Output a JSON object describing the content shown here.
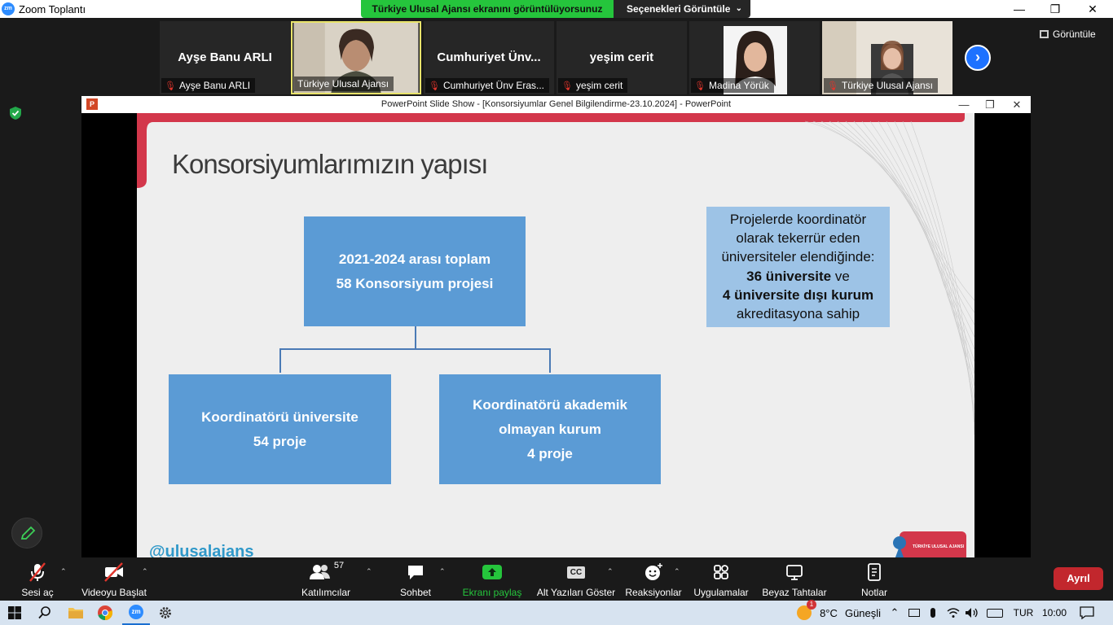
{
  "app": {
    "title": "Zoom Toplantı",
    "logo_text": "zm"
  },
  "share_banner": {
    "text": "Türkiye Ulusal Ajansı ekranını görüntülüyorsunuz",
    "options_label": "Seçenekleri Görüntüle"
  },
  "window_controls": {
    "minimize": "—",
    "restore": "❐",
    "close": "✕"
  },
  "gallery": {
    "view_label": "Görüntüle",
    "participants": [
      {
        "big_name": "Ayşe Banu ARLI",
        "label": "Ayşe Banu ARLI",
        "video": false
      },
      {
        "big_name": "",
        "label": "Türkiye Ulusal Ajansı",
        "video": true,
        "active": true
      },
      {
        "big_name": "Cumhuriyet  Ünv...",
        "label": "Cumhuriyet Ünv Eras...",
        "video": false
      },
      {
        "big_name": "yeşim cerit",
        "label": "yeşim cerit",
        "video": false
      },
      {
        "big_name": "",
        "label": "Madina Yörük",
        "video": true
      },
      {
        "big_name": "",
        "label": "Türkiye Ulusal Ajansı",
        "video": true
      }
    ]
  },
  "ppt": {
    "icon_text": "P",
    "window_title": "PowerPoint Slide Show  -  [Konsorsiyumlar Genel Bilgilendirme-23.10.2024]  -  PowerPoint",
    "slide": {
      "title": "Konsorsiyumlarımızın yapısı",
      "top_box": {
        "line1": "2021-2024 arası toplam",
        "line2": "58 Konsorsiyum projesi"
      },
      "left_box": {
        "line1": "Koordinatörü üniversite",
        "line2": "54 proje"
      },
      "right_box": {
        "line1": "Koordinatörü akademik",
        "line2": "olmayan kurum",
        "line3": "4 proje"
      },
      "info": {
        "line1": "Projelerde koordinatör",
        "line2": "olarak tekerrür eden",
        "line3": "üniversiteler elendiğinde:",
        "bold1": "36 üniversite",
        "mid": " ve",
        "bold2": "4 üniversite dışı kurum",
        "line6": "akreditasyona sahip"
      },
      "hashtag": "@ulusalajans",
      "logo_text": "TÜRKİYE ULUSAL AJANSI"
    }
  },
  "toolbar": {
    "unmute": "Sesi aç",
    "start_video": "Videoyu Başlat",
    "participants": "Katılımcılar",
    "participants_count": "57",
    "chat": "Sohbet",
    "share": "Ekranı paylaş",
    "captions": "Alt Yazıları Göster",
    "captions_icon": "CC",
    "reactions": "Reaksiyonlar",
    "apps": "Uygulamalar",
    "whiteboards": "Beyaz Tahtalar",
    "notes": "Notlar",
    "leave": "Ayrıl"
  },
  "taskbar": {
    "weather_temp": "8°C",
    "weather_text": "Güneşli",
    "weather_badge": "1",
    "language": "TUR",
    "time": "10:00",
    "zoom_icon_text": "zm"
  },
  "colors": {
    "accent_green": "#25c53c",
    "slide_box": "#5b9bd5",
    "info_box": "#9dc3e6",
    "slide_red": "#d3374b",
    "leave_red": "#c2272d",
    "zoom_blue": "#2d8cff"
  }
}
